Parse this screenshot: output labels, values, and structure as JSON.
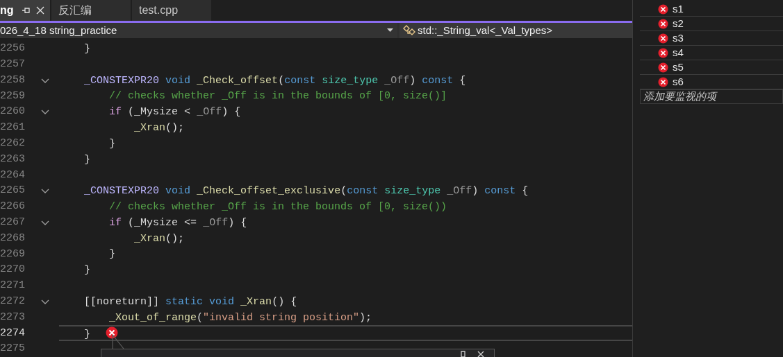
{
  "tabs": [
    {
      "label": "ng",
      "selected": true,
      "pinned": true
    },
    {
      "label": "反汇编",
      "selected": false,
      "pinned": false
    },
    {
      "label": "test.cpp",
      "selected": false,
      "pinned": false
    }
  ],
  "navigation": {
    "project": "026_4_18 string_practice",
    "scope": "std::_String_val<_Val_types>"
  },
  "code_lines": [
    {
      "number": "2256",
      "fold": false,
      "current": false,
      "tokens": [
        {
          "kind": "plain",
          "text": "    }"
        }
      ]
    },
    {
      "number": "2257",
      "fold": false,
      "current": false
    },
    {
      "number": "2258",
      "fold": true,
      "current": false,
      "tokens": [
        {
          "kind": "macro",
          "text": "    _CONSTEXPR20 "
        },
        {
          "kind": "keyword",
          "text": "void "
        },
        {
          "kind": "function",
          "text": "_Check_offset"
        },
        {
          "kind": "plain",
          "text": "("
        },
        {
          "kind": "keyword",
          "text": "const "
        },
        {
          "kind": "type",
          "text": "size_type "
        },
        {
          "kind": "param",
          "text": "_Off"
        },
        {
          "kind": "plain",
          "text": ") "
        },
        {
          "kind": "keyword",
          "text": "const "
        },
        {
          "kind": "plain",
          "text": "{"
        }
      ]
    },
    {
      "number": "2259",
      "fold": false,
      "current": false,
      "tokens": [
        {
          "kind": "comment",
          "text": "        // checks whether _Off is in the bounds of [0, size()]"
        }
      ]
    },
    {
      "number": "2260",
      "fold": true,
      "current": false,
      "tokens": [
        {
          "kind": "control",
          "text": "        if "
        },
        {
          "kind": "plain",
          "text": "("
        },
        {
          "kind": "field",
          "text": "_Mysize "
        },
        {
          "kind": "plain",
          "text": "< "
        },
        {
          "kind": "param",
          "text": "_Off"
        },
        {
          "kind": "plain",
          "text": ") {"
        }
      ]
    },
    {
      "number": "2261",
      "fold": false,
      "current": false,
      "tokens": [
        {
          "kind": "function",
          "text": "            _Xran"
        },
        {
          "kind": "plain",
          "text": "();"
        }
      ]
    },
    {
      "number": "2262",
      "fold": false,
      "current": false,
      "tokens": [
        {
          "kind": "plain",
          "text": "        }"
        }
      ]
    },
    {
      "number": "2263",
      "fold": false,
      "current": false,
      "tokens": [
        {
          "kind": "plain",
          "text": "    }"
        }
      ]
    },
    {
      "number": "2264",
      "fold": false,
      "current": false
    },
    {
      "number": "2265",
      "fold": true,
      "current": false,
      "tokens": [
        {
          "kind": "macro",
          "text": "    _CONSTEXPR20 "
        },
        {
          "kind": "keyword",
          "text": "void "
        },
        {
          "kind": "function",
          "text": "_Check_offset_exclusive"
        },
        {
          "kind": "plain",
          "text": "("
        },
        {
          "kind": "keyword",
          "text": "const "
        },
        {
          "kind": "type",
          "text": "size_type "
        },
        {
          "kind": "param",
          "text": "_Off"
        },
        {
          "kind": "plain",
          "text": ") "
        },
        {
          "kind": "keyword",
          "text": "const "
        },
        {
          "kind": "plain",
          "text": "{"
        }
      ]
    },
    {
      "number": "2266",
      "fold": false,
      "current": false,
      "tokens": [
        {
          "kind": "comment",
          "text": "        // checks whether _Off is in the bounds of [0, size())"
        }
      ]
    },
    {
      "number": "2267",
      "fold": true,
      "current": false,
      "tokens": [
        {
          "kind": "control",
          "text": "        if "
        },
        {
          "kind": "plain",
          "text": "("
        },
        {
          "kind": "field",
          "text": "_Mysize "
        },
        {
          "kind": "plain",
          "text": "<= "
        },
        {
          "kind": "param",
          "text": "_Off"
        },
        {
          "kind": "plain",
          "text": ") {"
        }
      ]
    },
    {
      "number": "2268",
      "fold": false,
      "current": false,
      "tokens": [
        {
          "kind": "function",
          "text": "            _Xran"
        },
        {
          "kind": "plain",
          "text": "();"
        }
      ]
    },
    {
      "number": "2269",
      "fold": false,
      "current": false,
      "tokens": [
        {
          "kind": "plain",
          "text": "        }"
        }
      ]
    },
    {
      "number": "2270",
      "fold": false,
      "current": false,
      "tokens": [
        {
          "kind": "plain",
          "text": "    }"
        }
      ]
    },
    {
      "number": "2271",
      "fold": false,
      "current": false
    },
    {
      "number": "2272",
      "fold": true,
      "current": false,
      "tokens": [
        {
          "kind": "plain",
          "text": "    [[noreturn]] "
        },
        {
          "kind": "keyword",
          "text": "static void "
        },
        {
          "kind": "function",
          "text": "_Xran"
        },
        {
          "kind": "plain",
          "text": "() {"
        }
      ]
    },
    {
      "number": "2273",
      "fold": false,
      "current": false,
      "tokens": [
        {
          "kind": "function",
          "text": "        _Xout_of_range"
        },
        {
          "kind": "plain",
          "text": "("
        },
        {
          "kind": "string",
          "text": "″invalid string position″"
        },
        {
          "kind": "plain",
          "text": ");"
        }
      ]
    },
    {
      "number": "2274",
      "fold": false,
      "current": true,
      "error": true,
      "tokens": [
        {
          "kind": "plain",
          "text": "    }"
        }
      ]
    },
    {
      "number": "2275",
      "fold": false,
      "current": false
    }
  ],
  "watch": {
    "items": [
      {
        "name": "s1",
        "error": true
      },
      {
        "name": "s2",
        "error": true
      },
      {
        "name": "s3",
        "error": true
      },
      {
        "name": "s4",
        "error": true
      },
      {
        "name": "s5",
        "error": true
      },
      {
        "name": "s6",
        "error": true
      }
    ],
    "add_placeholder": "添加要监视的项"
  }
}
